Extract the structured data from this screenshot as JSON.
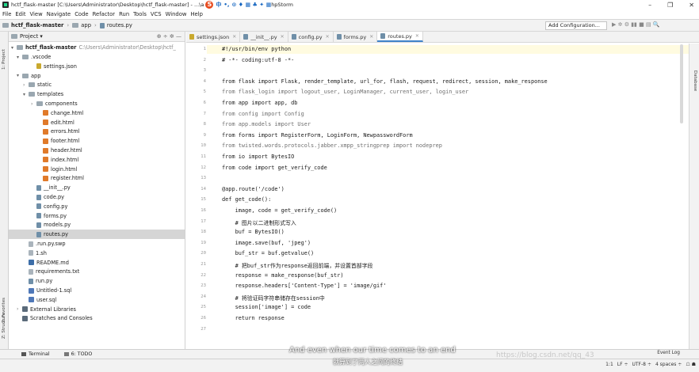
{
  "window": {
    "title": "hctf_flask-master [C:\\Users\\Administrator\\Desktop\\hctf_flask-master] - ...\\a",
    "title_tail": "hpStorm",
    "controls": [
      "–",
      "❐",
      "✕"
    ]
  },
  "ime": {
    "zh": "中",
    "dot": "•,",
    "symbols": "⊙ ♦ ▦ ♣ ✦ ▦"
  },
  "menu": [
    "File",
    "Edit",
    "View",
    "Navigate",
    "Code",
    "Refactor",
    "Run",
    "Tools",
    "VCS",
    "Window",
    "Help"
  ],
  "breadcrumb": [
    "hctf_flask-master",
    "app",
    "routes.py"
  ],
  "nav": {
    "config_label": "Add Configuration...",
    "tools": "▶ ✲ ⚙ ▮▮ ■ ▤ 🔍"
  },
  "stripe": {
    "project": "1: Project",
    "favorites": "2: Favorites",
    "structure": "Z: Structure",
    "database": "Database"
  },
  "project_panel": {
    "header": "Project ▾",
    "tools": "⊕ ÷ ✲ —",
    "root_name": "hctf_flask-master",
    "root_path": "C:\\Users\\Administrator\\Desktop\\hctf_"
  },
  "tree": [
    {
      "label": ".vscode",
      "arrow": "▾",
      "icon": "folder"
    },
    {
      "label": "settings.json",
      "arrow": "",
      "icon": "json"
    },
    {
      "label": "app",
      "arrow": "▾",
      "icon": "folder"
    },
    {
      "label": "static",
      "arrow": "›",
      "icon": "folder"
    },
    {
      "label": "templates",
      "arrow": "▾",
      "icon": "folder"
    },
    {
      "label": "components",
      "arrow": "›",
      "icon": "folder"
    },
    {
      "label": "change.html",
      "arrow": "",
      "icon": "html"
    },
    {
      "label": "edit.html",
      "arrow": "",
      "icon": "html"
    },
    {
      "label": "errors.html",
      "arrow": "",
      "icon": "html"
    },
    {
      "label": "footer.html",
      "arrow": "",
      "icon": "html"
    },
    {
      "label": "header.html",
      "arrow": "",
      "icon": "html"
    },
    {
      "label": "index.html",
      "arrow": "",
      "icon": "html"
    },
    {
      "label": "login.html",
      "arrow": "",
      "icon": "html"
    },
    {
      "label": "register.html",
      "arrow": "",
      "icon": "html"
    },
    {
      "label": "__init__.py",
      "arrow": "",
      "icon": "py"
    },
    {
      "label": "code.py",
      "arrow": "",
      "icon": "py"
    },
    {
      "label": "config.py",
      "arrow": "",
      "icon": "py"
    },
    {
      "label": "forms.py",
      "arrow": "",
      "icon": "py"
    },
    {
      "label": "models.py",
      "arrow": "",
      "icon": "py"
    },
    {
      "label": "routes.py",
      "arrow": "",
      "icon": "py",
      "selected": true
    },
    {
      "label": ".run.py.swp",
      "arrow": "",
      "icon": "file"
    },
    {
      "label": "1.sh",
      "arrow": "",
      "icon": "file"
    },
    {
      "label": "README.md",
      "arrow": "",
      "icon": "md"
    },
    {
      "label": "requirements.txt",
      "arrow": "",
      "icon": "file"
    },
    {
      "label": "run.py",
      "arrow": "",
      "icon": "py"
    },
    {
      "label": "Untitled-1.sql",
      "arrow": "",
      "icon": "sql"
    },
    {
      "label": "user.sql",
      "arrow": "",
      "icon": "sql"
    },
    {
      "label": "External Libraries",
      "arrow": "›",
      "icon": "lib"
    },
    {
      "label": "Scratches and Consoles",
      "arrow": "",
      "icon": "lib"
    }
  ],
  "tabs": [
    {
      "label": "settings.json"
    },
    {
      "label": "__init__.py"
    },
    {
      "label": "config.py"
    },
    {
      "label": "forms.py"
    },
    {
      "label": "routes.py",
      "active": true
    }
  ],
  "code": [
    {
      "n": "1",
      "t": "#!/usr/bin/env python"
    },
    {
      "n": "2",
      "t": "# -*- coding:utf-8 -*-"
    },
    {
      "n": "3",
      "t": ""
    },
    {
      "n": "4",
      "t": "from flask import Flask, render_template, url_for, flash, request, redirect, session, make_response"
    },
    {
      "n": "5",
      "t": "from flask_login import logout_user, LoginManager, current_user, login_user",
      "cm": true
    },
    {
      "n": "6",
      "t": "from app import app, db"
    },
    {
      "n": "7",
      "t": "from config import Config",
      "cm": true
    },
    {
      "n": "8",
      "t": "from app.models import User",
      "cm": true
    },
    {
      "n": "9",
      "t": "from forms import RegisterForm, LoginForm, NewpasswordForm"
    },
    {
      "n": "10",
      "t": "from twisted.words.protocols.jabber.xmpp_stringprep import nodeprep",
      "cm": true
    },
    {
      "n": "11",
      "t": "from io import BytesIO"
    },
    {
      "n": "12",
      "t": "from code import get_verify_code"
    },
    {
      "n": "13",
      "t": ""
    },
    {
      "n": "14",
      "t": "@app.route('/code')"
    },
    {
      "n": "15",
      "t": "def get_code():"
    },
    {
      "n": "16",
      "t": "    image, code = get_verify_code()"
    },
    {
      "n": "17",
      "t": "    # 图片以二进制形式写入"
    },
    {
      "n": "18",
      "t": "    buf = BytesIO()"
    },
    {
      "n": "19",
      "t": "    image.save(buf, 'jpeg')"
    },
    {
      "n": "20",
      "t": "    buf_str = buf.getvalue()"
    },
    {
      "n": "21",
      "t": "    # 把buf_str作为response返回前端，并设置首部字段"
    },
    {
      "n": "22",
      "t": "    response = make_response(buf_str)"
    },
    {
      "n": "23",
      "t": "    response.headers['Content-Type'] = 'image/gif'"
    },
    {
      "n": "24",
      "t": "    # 将验证码字符串储存在session中"
    },
    {
      "n": "25",
      "t": "    session['image'] = code"
    },
    {
      "n": "26",
      "t": "    return response"
    },
    {
      "n": "27",
      "t": ""
    }
  ],
  "bottom": {
    "terminal": "Terminal",
    "todo": "6: TODO",
    "event_log": "Event Log"
  },
  "status": {
    "pos": "1:1",
    "lf": "LF ÷",
    "enc": "UTF-8 ÷",
    "indent": "4 spaces ÷",
    "extra": "☖ ☗"
  },
  "subtitles": {
    "en": "And even when our time comes to an end",
    "zh": "就算到了两人之间的终结",
    "watermark": "https://blog.csdn.net/qq_43"
  }
}
